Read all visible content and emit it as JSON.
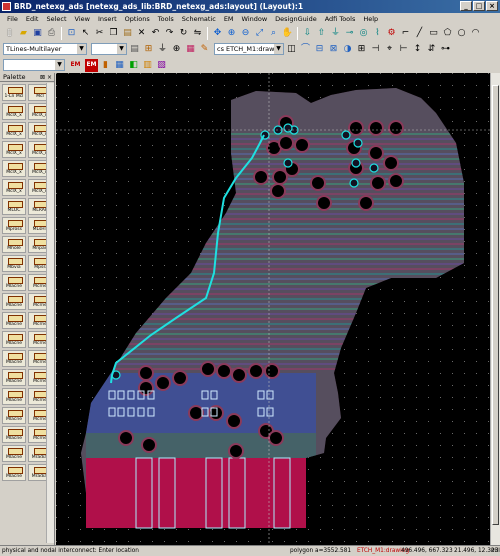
{
  "window": {
    "title": "BRD_netexg_ads [netexg_ads_lib:BRD_netexg_ads:layout] (Layout):1",
    "controls": [
      "_",
      "□",
      "×"
    ]
  },
  "menus": [
    "File",
    "Edit",
    "Select",
    "View",
    "Insert",
    "Options",
    "Tools",
    "Schematic",
    "EM",
    "Window",
    "DesignGuide",
    "Adfi Tools",
    "Help"
  ],
  "toolbar2": {
    "library_combo": "TLines-Multilayer",
    "layer_combo": "cs ETCH_M1:drawing"
  },
  "toolbar3": {
    "em_label_1": "EM",
    "em_label_2": "EM"
  },
  "palette": {
    "title": "Palette",
    "items": [
      "1-Ln Mcl",
      "Mcl",
      "MclX_x",
      "MclX_n",
      "MclX_x",
      "MclX_n",
      "MclX_x",
      "MclX_n",
      "MclX_x",
      "MclX_n",
      "MclX_x",
      "MclX_n",
      "MLOC",
      "MLRAP",
      "Mpross",
      "MLsHT",
      "Mhole",
      "Mnpad",
      "Mbvia",
      "Mpss",
      "Mlacne",
      "Mcrne",
      "Mlacne",
      "Mcrne",
      "Mlacne",
      "Mcrne",
      "Mlacne",
      "Mcrne",
      "Mlacne",
      "Mcrne",
      "Mlacne",
      "Mcrne",
      "Mlacne",
      "Mcrne",
      "Mlacne",
      "Mcrne",
      "Mlacne",
      "Mcrne",
      "Mlacne",
      "Mradial",
      "Mlacne",
      "Mradial"
    ]
  },
  "status": {
    "hint": "physical and nodal interconnect: Enter location",
    "polygon": "polygon a=3552.581",
    "layer": "ETCH_M1:drawing",
    "coords": "496.496, 667.323",
    "coords2": "21.496, 12.323",
    "units": "mil"
  },
  "colors": {
    "layer_status": "#c00000",
    "canvas": "#000000",
    "trace": "#1fe0e0"
  }
}
